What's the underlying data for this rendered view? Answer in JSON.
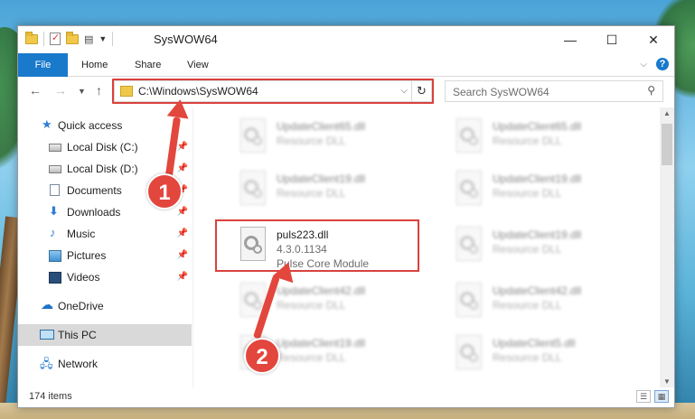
{
  "window": {
    "title": "SysWOW64",
    "minimize_glyph": "—",
    "maximize_glyph": "☐",
    "close_glyph": "✕"
  },
  "ribbon": {
    "tabs": [
      "File",
      "Home",
      "Share",
      "View"
    ],
    "help_glyph": "?"
  },
  "nav": {
    "address_path": "C:\\Windows\\SysWOW64",
    "search_placeholder": "Search SysWOW64"
  },
  "sidebar": {
    "items": [
      {
        "label": "Quick access",
        "icon": "star-icon",
        "pinned": false
      },
      {
        "label": "Local Disk (C:)",
        "icon": "drive-icon",
        "pinned": true
      },
      {
        "label": "Local Disk (D:)",
        "icon": "drive-icon",
        "pinned": true
      },
      {
        "label": "Documents",
        "icon": "documents-icon",
        "pinned": true
      },
      {
        "label": "Downloads",
        "icon": "downloads-icon",
        "pinned": true
      },
      {
        "label": "Music",
        "icon": "music-icon",
        "pinned": true
      },
      {
        "label": "Pictures",
        "icon": "pictures-icon",
        "pinned": true
      },
      {
        "label": "Videos",
        "icon": "videos-icon",
        "pinned": true
      },
      {
        "label": "OneDrive",
        "icon": "onedrive-icon",
        "pinned": false
      },
      {
        "label": "This PC",
        "icon": "this-pc-icon",
        "pinned": false,
        "selected": true
      },
      {
        "label": "Network",
        "icon": "network-icon",
        "pinned": false
      }
    ]
  },
  "files": [
    {
      "name": "UpdateClient65.dll",
      "line2": "Resource DLL",
      "line3": "",
      "blurred": true
    },
    {
      "name": "UpdateClient65.dll",
      "line2": "Resource DLL",
      "line3": "",
      "blurred": true
    },
    {
      "name": "UpdateClient19.dll",
      "line2": "Resource DLL",
      "line3": "",
      "blurred": true
    },
    {
      "name": "UpdateClient19.dll",
      "line2": "Resource DLL",
      "line3": "",
      "blurred": true
    },
    {
      "name": "puls223.dll",
      "line2": "4.3.0.1134",
      "line3": "Pulse Core Module",
      "blurred": false
    },
    {
      "name": "UpdateClient19.dll",
      "line2": "Resource DLL",
      "line3": "",
      "blurred": true
    },
    {
      "name": "UpdateClient42.dll",
      "line2": "Resource DLL",
      "line3": "",
      "blurred": true
    },
    {
      "name": "UpdateClient42.dll",
      "line2": "Resource DLL",
      "line3": "",
      "blurred": true
    },
    {
      "name": "UpdateClient19.dll",
      "line2": "Resource DLL",
      "line3": "",
      "blurred": true
    },
    {
      "name": "UpdateClient5.dll",
      "line2": "Resource DLL",
      "line3": "",
      "blurred": true
    }
  ],
  "status": {
    "item_count": "174 items"
  },
  "annotations": {
    "step1": "1",
    "step2": "2",
    "color": "#e2463d"
  }
}
